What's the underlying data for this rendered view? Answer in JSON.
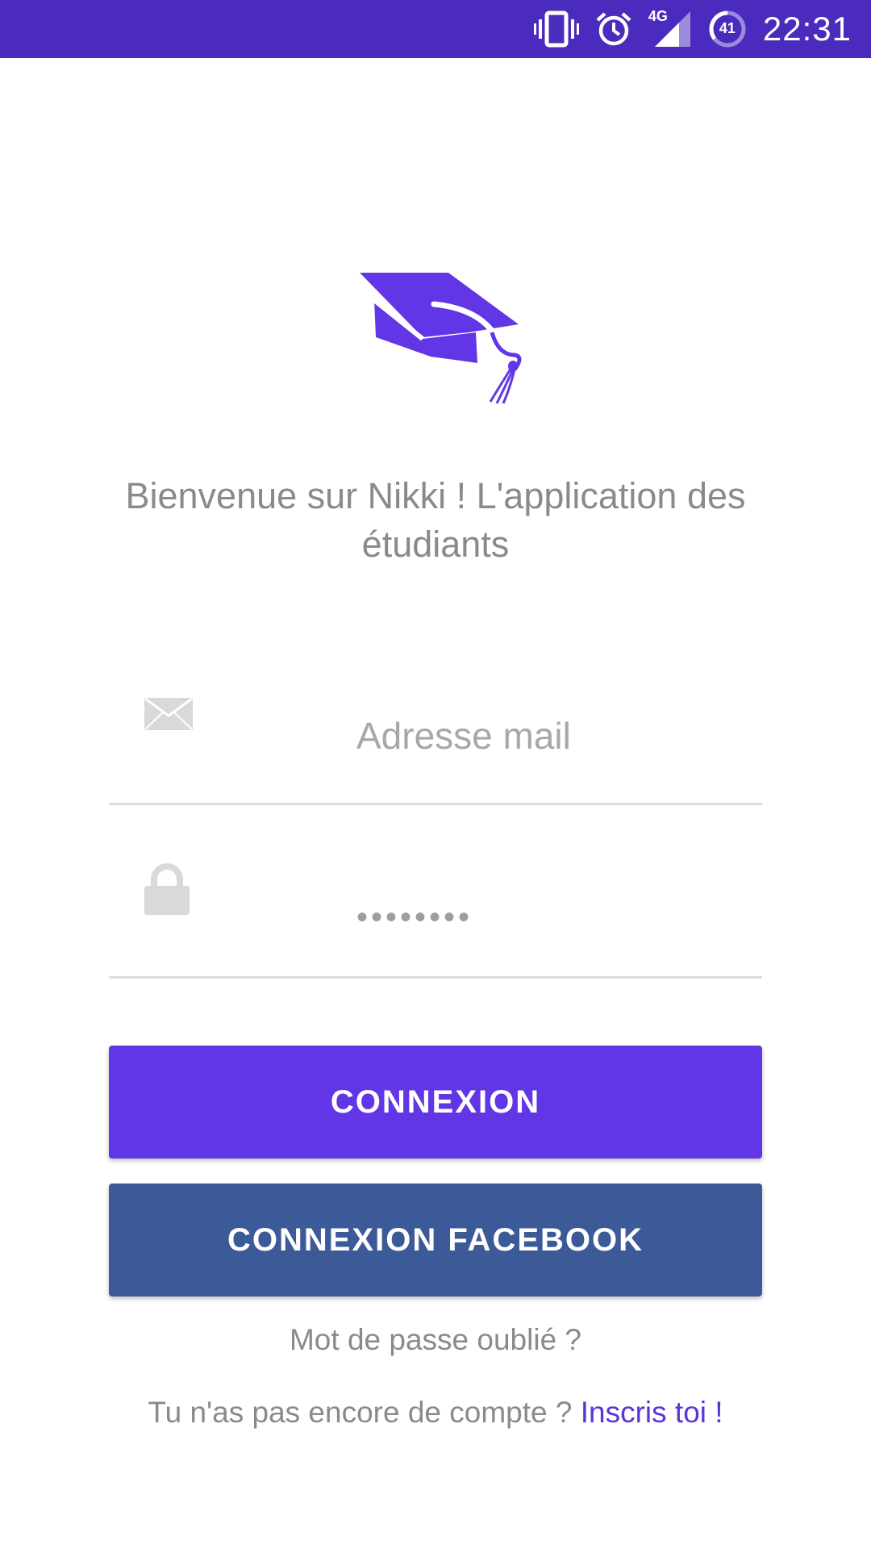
{
  "status_bar": {
    "background": "#4b2bbd",
    "icons": [
      "vibrate-icon",
      "alarm-icon",
      "signal-4g-icon",
      "battery-icon"
    ],
    "network_label": "4G",
    "battery_level": "41",
    "time": "22:31"
  },
  "logo": {
    "icon": "graduation-cap-icon",
    "color": "#6236e6"
  },
  "welcome_text": "Bienvenue sur Nikki ! L'application des étudiants",
  "email_field": {
    "icon": "envelope-icon",
    "placeholder": "Adresse mail",
    "value": ""
  },
  "password_field": {
    "icon": "lock-icon",
    "value": "••••••••"
  },
  "buttons": {
    "connect_label": "CONNEXION",
    "connect_color": "#6236e6",
    "facebook_label": "CONNEXION FACEBOOK",
    "facebook_color": "#3d5a98"
  },
  "forgot_password": "Mot de passe oublié ?",
  "signup": {
    "prompt": "Tu n'as pas encore de compte ?",
    "link": "Inscris toi !"
  }
}
